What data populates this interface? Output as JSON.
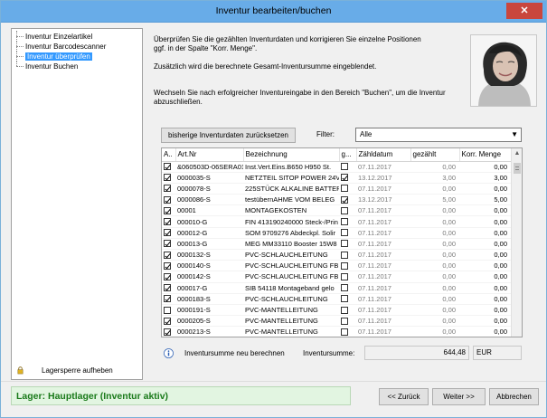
{
  "window": {
    "title": "Inventur bearbeiten/buchen",
    "close": "✕"
  },
  "nav": {
    "items": [
      {
        "label": "Inventur Einzelartikel",
        "selected": false
      },
      {
        "label": "Inventur Barcodescanner",
        "selected": false
      },
      {
        "label": "Inventur überprüfen",
        "selected": true
      },
      {
        "label": "Inventur Buchen",
        "selected": false
      }
    ],
    "lagersperre_label": "Lagersperre aufheben"
  },
  "info": {
    "line1": "Überprüfen Sie die gezählten Inventurdaten und korrigieren Sie einzelne Positionen",
    "line2": "ggf. in der Spalte \"Korr. Menge\".",
    "line3": "Zusätzlich wird die berechnete Gesamt-Inventursumme eingeblendet.",
    "line4": "Wechseln Sie nach erfolgreicher Inventureingabe in den Bereich \"Buchen\", um die Inventur",
    "line5": "abzuschließen."
  },
  "toolbar": {
    "reset_label": "bisherige Inventurdaten zurücksetzen",
    "filter_label": "Filter:",
    "filter_value": "Alle"
  },
  "grid": {
    "columns": [
      "A..",
      "Art.Nr",
      "Bezeichnung",
      "g...",
      "Zähldatum",
      "gezählt",
      "Korr. Menge"
    ],
    "rows": [
      {
        "a": true,
        "art": "&060503D-06SERA01",
        "bez": "Inst.Vert.Eins.B650 H950 St.",
        "g": false,
        "datum": "07.11.2017",
        "gezaehlt": "0,00",
        "korr": "0,00"
      },
      {
        "a": true,
        "art": "0000035-S",
        "bez": "NETZTEIL SITOP POWER 24V/",
        "g": true,
        "datum": "13.12.2017",
        "gezaehlt": "3,00",
        "korr": "3,00"
      },
      {
        "a": true,
        "art": "0000078-S",
        "bez": "225STÜCK ALKALINE BATTER",
        "g": false,
        "datum": "07.11.2017",
        "gezaehlt": "0,00",
        "korr": "0,00"
      },
      {
        "a": true,
        "art": "0000086-S",
        "bez": "testübernAHME VOM BELEG",
        "g": true,
        "datum": "13.12.2017",
        "gezaehlt": "5,00",
        "korr": "5,00"
      },
      {
        "a": true,
        "art": "00001",
        "bez": "MONTAGEKOSTEN",
        "g": false,
        "datum": "07.11.2017",
        "gezaehlt": "0,00",
        "korr": "0,00"
      },
      {
        "a": true,
        "art": "000010-G",
        "bez": "FIN 413190240000 Steck-/Prin",
        "g": false,
        "datum": "07.11.2017",
        "gezaehlt": "0,00",
        "korr": "0,00"
      },
      {
        "a": true,
        "art": "000012-G",
        "bez": "SOM 9709276  Abdeckpl. Solir",
        "g": false,
        "datum": "07.11.2017",
        "gezaehlt": "0,00",
        "korr": "0,00"
      },
      {
        "a": true,
        "art": "000013-G",
        "bez": "MEG MM33110 Booster 15W8",
        "g": false,
        "datum": "07.11.2017",
        "gezaehlt": "0,00",
        "korr": "0,00"
      },
      {
        "a": true,
        "art": "0000132-S",
        "bez": "PVC-SCHLAUCHLEITUNG",
        "g": false,
        "datum": "07.11.2017",
        "gezaehlt": "0,00",
        "korr": "0,00"
      },
      {
        "a": true,
        "art": "0000140-S",
        "bez": "PVC-SCHLAUCHLEITUNG FB.",
        "g": false,
        "datum": "07.11.2017",
        "gezaehlt": "0,00",
        "korr": "0,00"
      },
      {
        "a": true,
        "art": "0000142-S",
        "bez": "PVC-SCHLAUCHLEITUNG FB.",
        "g": false,
        "datum": "07.11.2017",
        "gezaehlt": "0,00",
        "korr": "0,00"
      },
      {
        "a": true,
        "art": "000017-G",
        "bez": "SIB 54118 Montageband gelo",
        "g": false,
        "datum": "07.11.2017",
        "gezaehlt": "0,00",
        "korr": "0,00"
      },
      {
        "a": true,
        "art": "0000183-S",
        "bez": "PVC-SCHLAUCHLEITUNG",
        "g": false,
        "datum": "07.11.2017",
        "gezaehlt": "0,00",
        "korr": "0,00"
      },
      {
        "a": false,
        "art": "0000191-S",
        "bez": "PVC-MANTELLEITUNG",
        "g": false,
        "datum": "07.11.2017",
        "gezaehlt": "0,00",
        "korr": "0,00"
      },
      {
        "a": true,
        "art": "0000205-S",
        "bez": "PVC-MANTELLEITUNG",
        "g": false,
        "datum": "07.11.2017",
        "gezaehlt": "0,00",
        "korr": "0,00"
      },
      {
        "a": true,
        "art": "0000213-S",
        "bez": "PVC-MANTELLEITUNG",
        "g": false,
        "datum": "07.11.2017",
        "gezaehlt": "0,00",
        "korr": "0,00"
      }
    ]
  },
  "summary": {
    "recalc_label": "Inventursumme neu berechnen",
    "sum_label": "Inventursumme:",
    "sum_value": "644,48",
    "currency": "EUR"
  },
  "status": {
    "text": "Lager: Hauptlager (Inventur aktiv)"
  },
  "buttons": {
    "back": "<< Zurück",
    "next": "Weiter >>",
    "cancel": "Abbrechen"
  }
}
